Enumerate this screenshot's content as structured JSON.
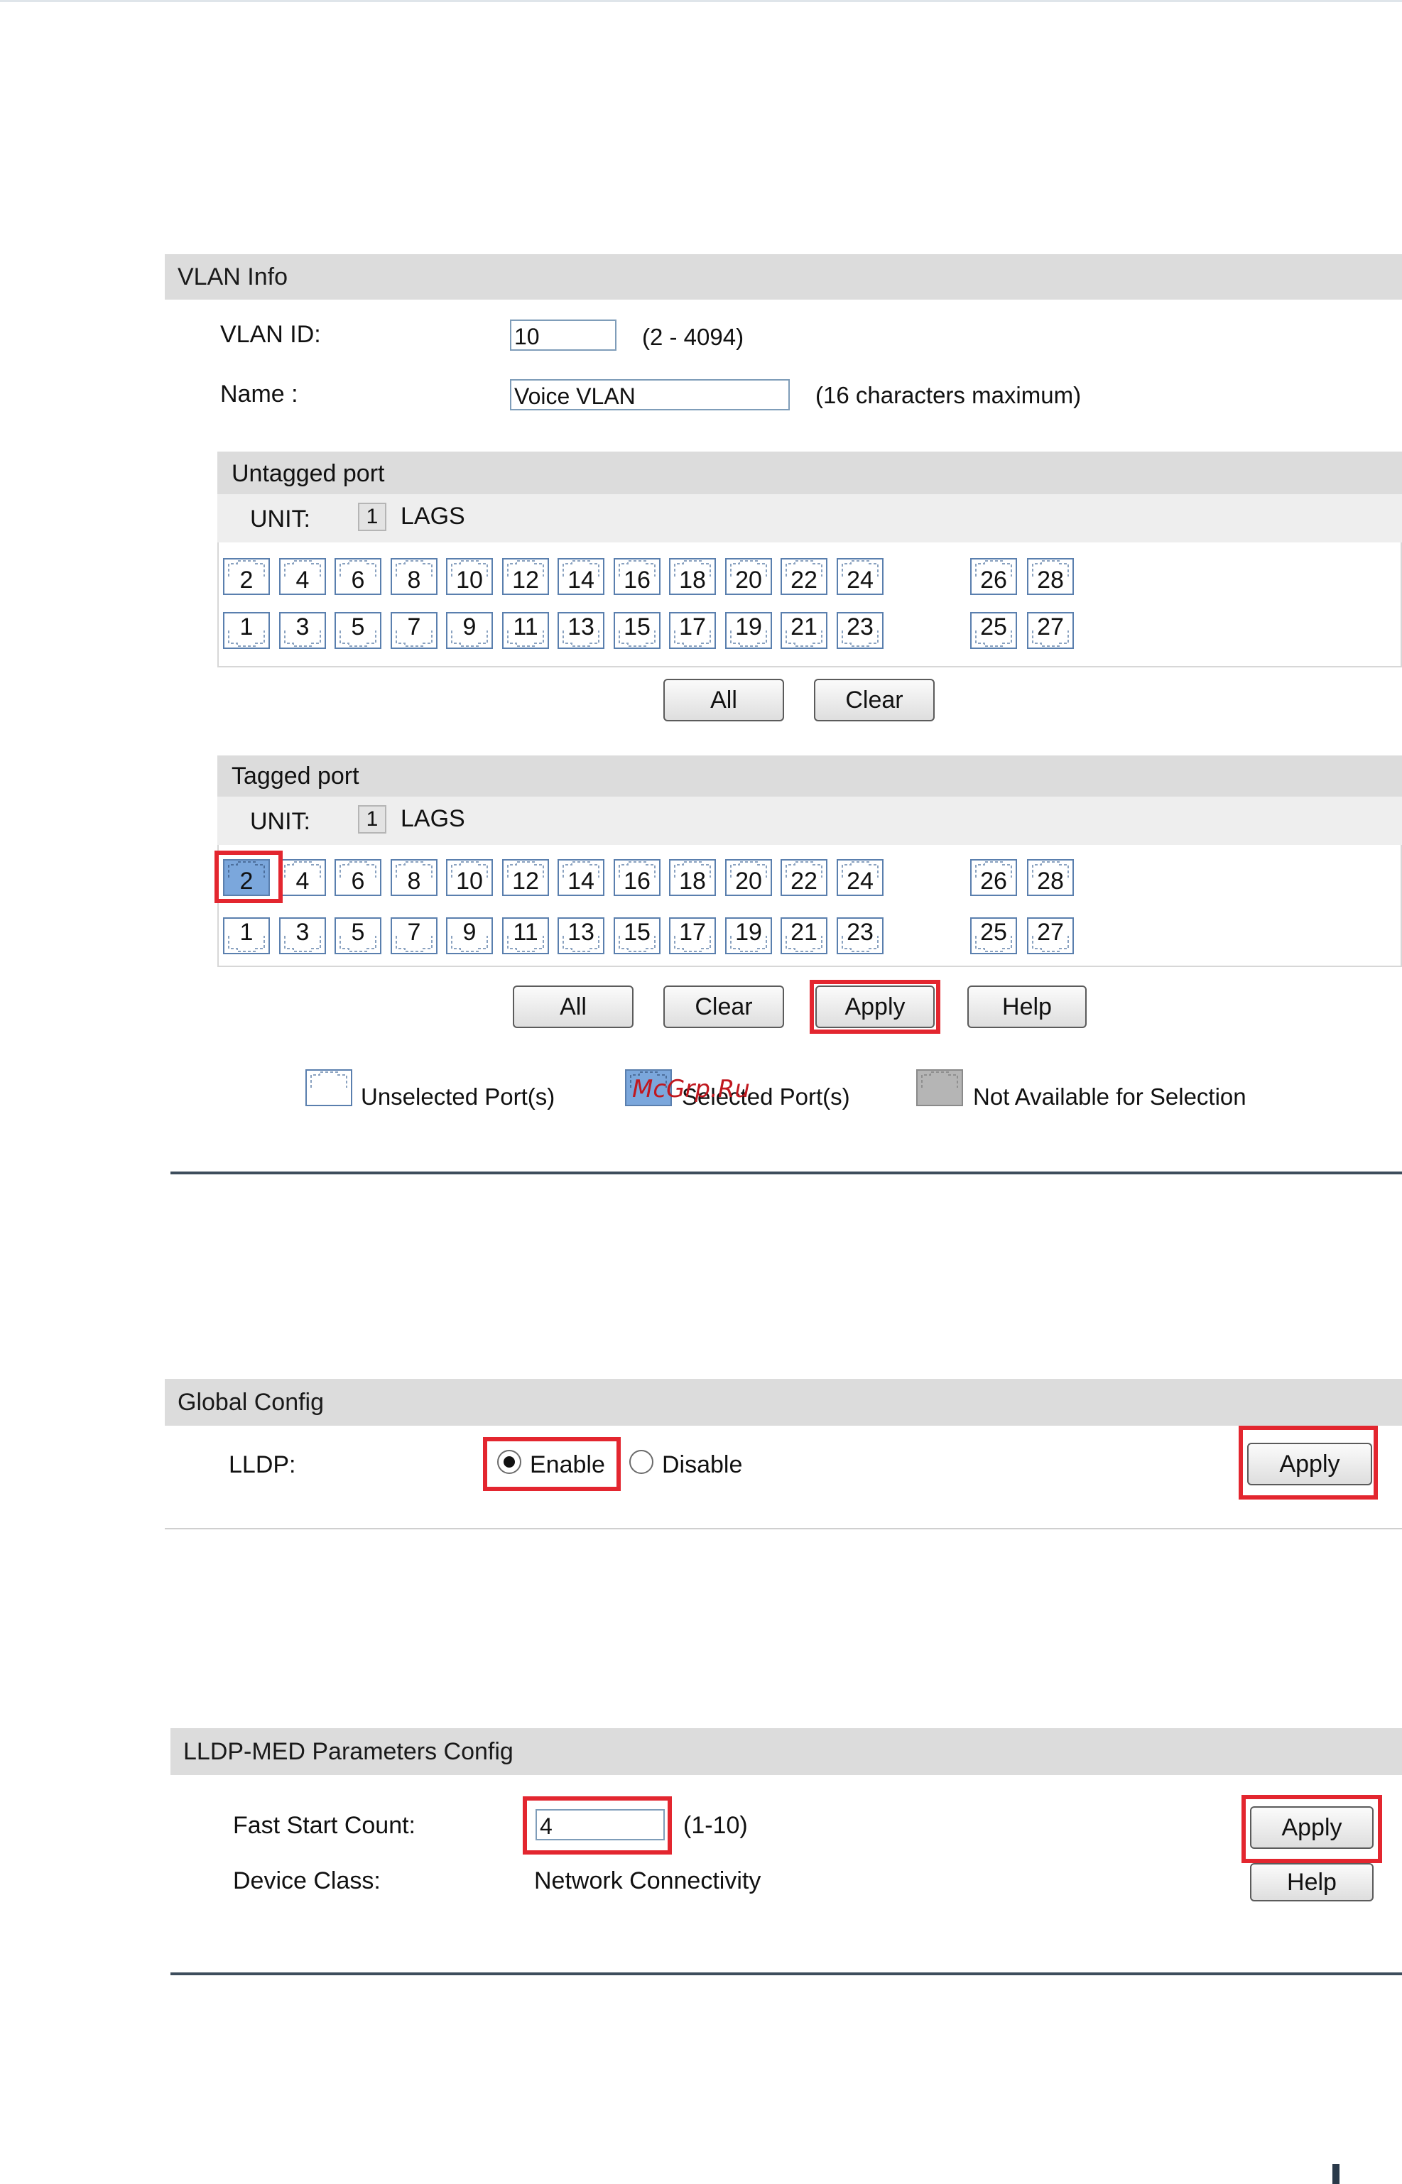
{
  "vlan_info": {
    "title": "VLAN Info",
    "vlan_id_label": "VLAN ID:",
    "vlan_id_value": "10",
    "vlan_id_hint": "(2 - 4094)",
    "name_label": "Name :",
    "name_value": "Voice VLAN",
    "name_hint": "(16 characters maximum)"
  },
  "untagged": {
    "title": "Untagged port",
    "unit_label": "UNIT:",
    "unit_value": "1",
    "lags_label": "LAGS",
    "top_ports": [
      "2",
      "4",
      "6",
      "8",
      "10",
      "12",
      "14",
      "16",
      "18",
      "20",
      "22",
      "24",
      "26",
      "28"
    ],
    "bottom_ports": [
      "1",
      "3",
      "5",
      "7",
      "9",
      "11",
      "13",
      "15",
      "17",
      "19",
      "21",
      "23",
      "25",
      "27"
    ],
    "all_label": "All",
    "clear_label": "Clear"
  },
  "tagged": {
    "title": "Tagged port",
    "unit_label": "UNIT:",
    "unit_value": "1",
    "lags_label": "LAGS",
    "top_ports": [
      "2",
      "4",
      "6",
      "8",
      "10",
      "12",
      "14",
      "16",
      "18",
      "20",
      "22",
      "24",
      "26",
      "28"
    ],
    "bottom_ports": [
      "1",
      "3",
      "5",
      "7",
      "9",
      "11",
      "13",
      "15",
      "17",
      "19",
      "21",
      "23",
      "25",
      "27"
    ],
    "selected_port": "2",
    "all_label": "All",
    "clear_label": "Clear",
    "apply_label": "Apply",
    "help_label": "Help"
  },
  "legend": {
    "unselected": "Unselected Port(s)",
    "selected": "Selected Port(s)",
    "not_available": "Not Available for Selection",
    "watermark": "McGrp.Ru"
  },
  "global_config": {
    "title": "Global Config",
    "lldp_label": "LLDP:",
    "enable_label": "Enable",
    "disable_label": "Disable",
    "selected": "Enable",
    "apply_label": "Apply"
  },
  "lldp_med": {
    "title": "LLDP-MED Parameters Config",
    "fast_start_label": "Fast Start Count:",
    "fast_start_value": "4",
    "fast_start_hint": "(1-10)",
    "device_class_label": "Device Class:",
    "device_class_value": "Network Connectivity",
    "apply_label": "Apply",
    "help_label": "Help"
  },
  "colors": {
    "highlight": "#e3262f",
    "selected_port": "#7ba7dc",
    "header_bar": "#dcdcdc",
    "rule": "#3d4d5c"
  }
}
